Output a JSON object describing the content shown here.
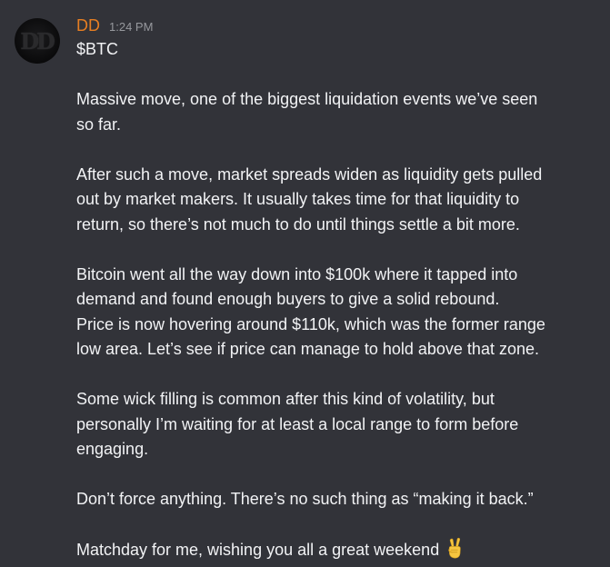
{
  "author": {
    "avatar_text": "DD",
    "name": "DD",
    "name_color": "#e67e22",
    "timestamp": "1:24 PM"
  },
  "message": {
    "ticker": "$BTC",
    "p1": [
      "Massive move, one of the biggest liquidation events we’ve seen",
      "so far."
    ],
    "p2": [
      "After such a move, market spreads widen as liquidity gets pulled",
      "out by market makers. It usually takes time for that liquidity to",
      "return, so there’s not much to do until things settle a bit more."
    ],
    "p3": [
      "Bitcoin went all the way down into $100k where it tapped into",
      "demand and found enough buyers to give a solid rebound.",
      "Price is now hovering around $110k, which was the former range",
      "low area. Let’s see if price can manage to hold above that zone."
    ],
    "p4": [
      "Some wick filling is common after this kind of volatility, but",
      "personally I’m waiting for at least a local range to form before",
      "engaging."
    ],
    "p5": [
      "Don’t force anything. There’s no such thing as “making it back.”"
    ],
    "p6": "Matchday for me, wishing you all a great weekend",
    "emoji": "victory-hand-emoji"
  },
  "theme": {
    "background": "#323339",
    "text": "#f2f3f5",
    "timestamp": "#96989d"
  }
}
